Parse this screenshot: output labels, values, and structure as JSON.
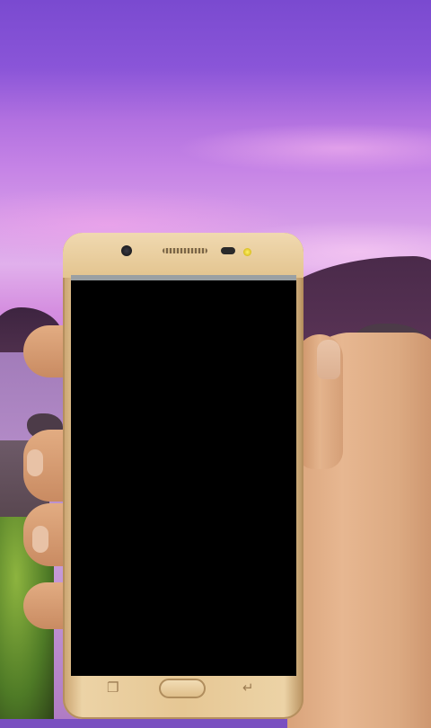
{
  "scene": {
    "description_icons": [
      "phone-frame",
      "hand",
      "landscape-background"
    ]
  },
  "phone": {
    "color": "#e6c794",
    "screen_color": "#000000",
    "buttons": {
      "recent_icon": "recent-apps-icon",
      "home_icon": "home-button",
      "back_icon": "back-arrow-icon"
    }
  },
  "colors": {
    "sky_top": "#7a4ad0",
    "sky_bottom": "#d49ae8",
    "moss": "#7fa33a"
  }
}
